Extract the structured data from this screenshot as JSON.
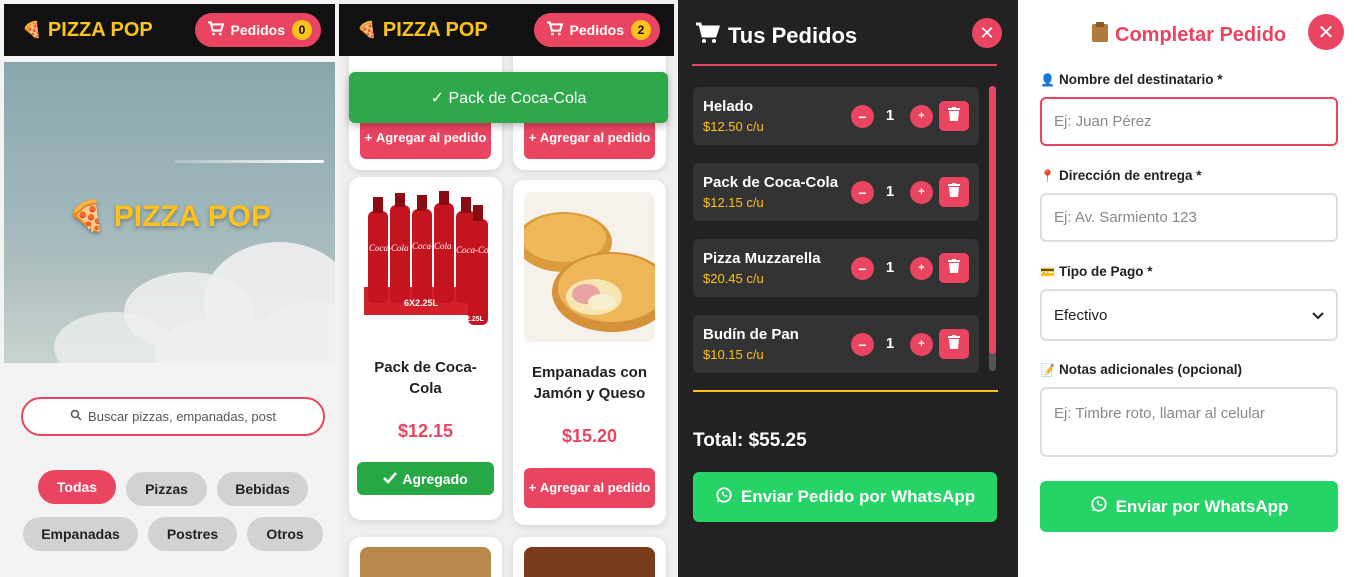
{
  "app": {
    "brand": "PIZZA POP",
    "orders_label": "Pedidos"
  },
  "panel1": {
    "order_count": "0",
    "hero_title": "PIZZA POP",
    "search_placeholder": "Buscar pizzas, empanadas, post",
    "categories": [
      "Todas",
      "Pizzas",
      "Bebidas",
      "Empanadas",
      "Postres",
      "Otros"
    ],
    "active_category": "Todas"
  },
  "panel2": {
    "order_count": "2",
    "toast": "✓ Pack de Coca-Cola",
    "add_label": "Agregar al pedido",
    "added_label": "Agregado",
    "products": [
      {
        "name": "Pack de Coca-Cola",
        "price": "$12.15",
        "state": "added"
      },
      {
        "name": "Empanadas con Jamón y Queso",
        "price": "$15.20",
        "state": "add"
      }
    ],
    "bottle_label": "6X2.25L",
    "bottle_size": "2.25L",
    "bottle_brand": "Coca-Cola"
  },
  "panel3": {
    "title": "Tus Pedidos",
    "items": [
      {
        "name": "Helado",
        "price": "$12.50 c/u",
        "qty": "1"
      },
      {
        "name": "Pack de Coca-Cola",
        "price": "$12.15 c/u",
        "qty": "1"
      },
      {
        "name": "Pizza Muzzarella",
        "price": "$20.45 c/u",
        "qty": "1"
      },
      {
        "name": "Budín de Pan",
        "price": "$10.15 c/u",
        "qty": "1"
      }
    ],
    "total": "Total: $55.25",
    "send_label": "Enviar Pedido por WhatsApp"
  },
  "panel4": {
    "title": "Completar Pedido",
    "name_label": "Nombre del destinatario *",
    "name_placeholder": "Ej: Juan Pérez",
    "address_label": "Dirección de entrega *",
    "address_placeholder": "Ej: Av. Sarmiento 123",
    "payment_label": "Tipo de Pago *",
    "payment_value": "Efectivo",
    "notes_label": "Notas adicionales (opcional)",
    "notes_placeholder": "Ej: Timbre roto, llamar al celular",
    "send_label": "Enviar por WhatsApp"
  },
  "colors": {
    "primary": "#e94560",
    "gold": "#ffc21a",
    "success": "#28a745",
    "whatsapp": "#25d366",
    "dark": "#111111",
    "drawer": "#222222"
  },
  "icons": {
    "brand": "pizza-slice-icon",
    "cart": "cart-icon",
    "search": "search-icon",
    "check": "check-icon",
    "plus": "plus-icon",
    "minus": "minus-icon",
    "trash": "trash-icon",
    "close": "close-icon",
    "whatsapp": "whatsapp-icon",
    "clipboard": "clipboard-icon",
    "person": "person-icon",
    "pin": "pin-icon",
    "card": "credit-card-icon",
    "memo": "memo-icon",
    "chevron": "chevron-down-icon"
  }
}
